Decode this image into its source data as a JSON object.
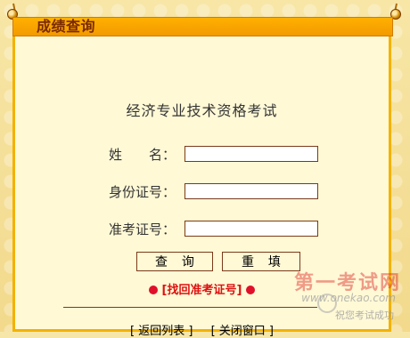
{
  "header": {
    "title": "成绩查询"
  },
  "form": {
    "exam_title": "经济专业技术资格考试",
    "fields": [
      {
        "label": "姓　　名：",
        "value": "",
        "placeholder": ""
      },
      {
        "label": "身份证号：",
        "value": "",
        "placeholder": ""
      },
      {
        "label": "准考证号：",
        "value": "",
        "placeholder": ""
      }
    ],
    "buttons": {
      "query": "查 询",
      "reset": "重 填"
    },
    "find_ticket_link": "[找回准考证号]"
  },
  "footer": {
    "back_to_list": "[ 返回列表 ]",
    "close_window": "[ 关闭窗口 ]"
  },
  "watermark": {
    "site_cn": "第一考试网",
    "site_url": "www.onekao.com",
    "slogan": "祝您考试成功"
  },
  "colors": {
    "header_bg": "#f6a300",
    "title_text": "#7a2a00",
    "link_red": "#d11111",
    "panel_bg": "#fff9d6"
  }
}
